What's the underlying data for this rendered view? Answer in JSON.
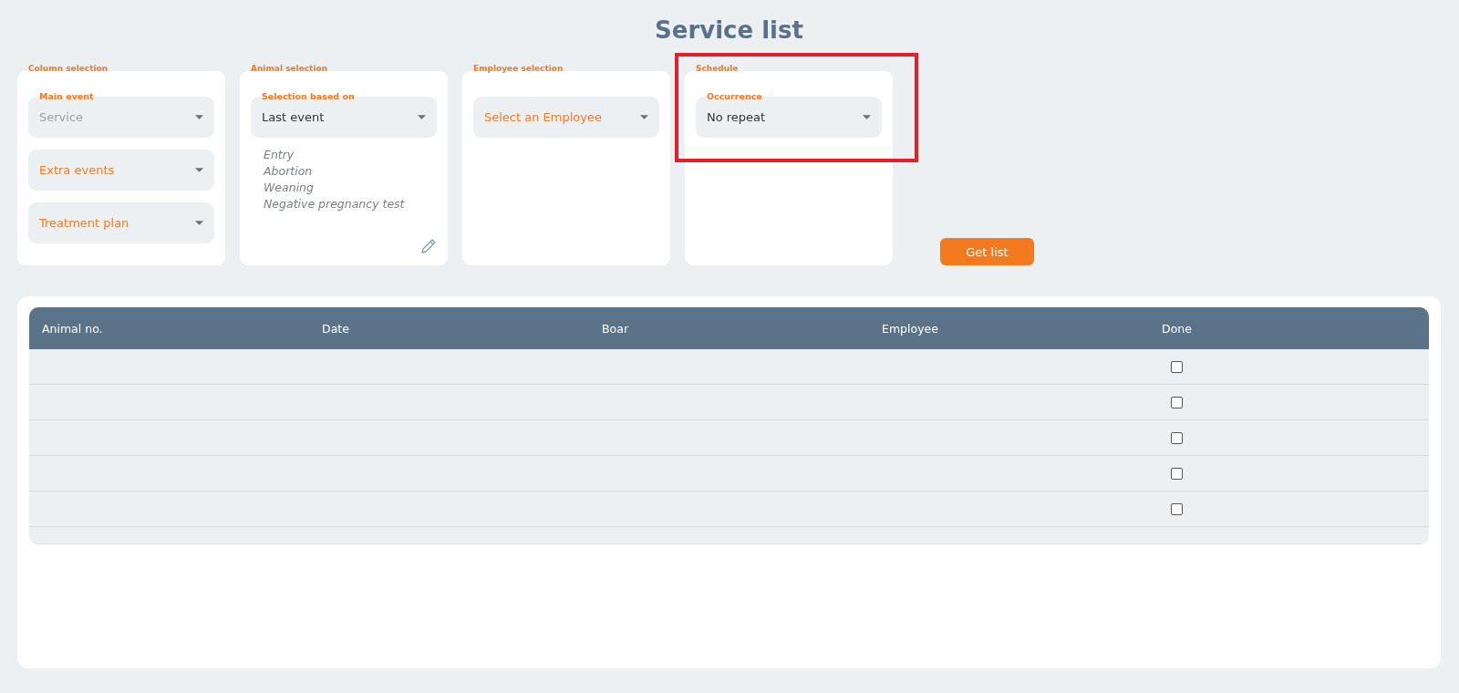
{
  "title": "Service list",
  "panels": [
    {
      "title": "Column selection",
      "highlighted": false,
      "fields": [
        {
          "label": "Main event",
          "value": "Service",
          "disabled": true
        },
        {
          "placeholder": "Extra events",
          "disabled": false
        },
        {
          "placeholder": "Treatment plan",
          "disabled": false
        }
      ]
    },
    {
      "title": "Animal selection",
      "highlighted": false,
      "fields": [
        {
          "label": "Selection based on",
          "value": "Last event",
          "disabled": false
        }
      ],
      "events": [
        "Entry",
        "Abortion",
        "Weaning",
        "Negative pregnancy test"
      ],
      "editable": true
    },
    {
      "title": "Employee selection",
      "highlighted": false,
      "fields": [
        {
          "placeholder": "Select an Employee",
          "disabled": false
        }
      ]
    },
    {
      "title": "Schedule",
      "highlighted": true,
      "fields": [
        {
          "label": "Occurrence",
          "value": "No repeat",
          "disabled": false
        }
      ]
    }
  ],
  "get_list_button": "Get list",
  "table": {
    "columns": [
      "Animal no.",
      "Date",
      "Boar",
      "Employee",
      "Done"
    ],
    "rows": [
      {
        "done": false
      },
      {
        "done": false
      },
      {
        "done": false
      },
      {
        "done": false
      },
      {
        "done": false
      }
    ]
  }
}
